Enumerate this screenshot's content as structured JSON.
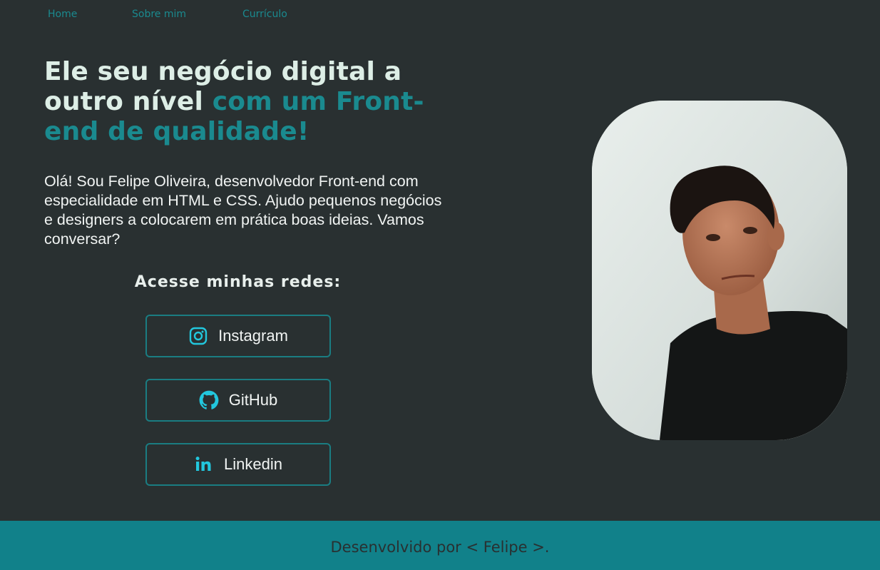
{
  "nav": {
    "items": [
      {
        "label": "Home"
      },
      {
        "label": "Sobre mim"
      },
      {
        "label": "Currículo"
      }
    ]
  },
  "hero": {
    "headline_part1": "Ele seu negócio digital a outro nível ",
    "headline_part2": "com um Front-end de qualidade!",
    "intro": "Olá! Sou Felipe Oliveira, desenvolvedor Front-end com especialidade em HTML e CSS. Ajudo pequenos negócios e designers a colocarem em prática boas ideias. Vamos conversar?"
  },
  "social": {
    "title": "Acesse minhas redes:",
    "buttons": [
      {
        "label": "Instagram",
        "icon": "instagram-icon"
      },
      {
        "label": "GitHub",
        "icon": "github-icon"
      },
      {
        "label": "Linkedin",
        "icon": "linkedin-icon"
      }
    ]
  },
  "footer": {
    "text": "Desenvolvido por < Felipe >."
  },
  "colors": {
    "background": "#293031",
    "accent": "#1a8a8f",
    "footer": "#11818a",
    "icon": "#22c7dd"
  }
}
